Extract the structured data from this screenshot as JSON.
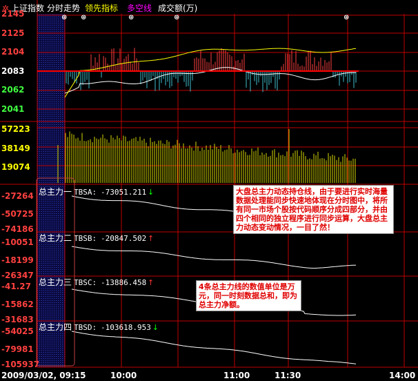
{
  "header": {
    "icon": "gear-icon",
    "items": [
      {
        "label": "上证指数",
        "color": "#ffffff"
      },
      {
        "label": "分时走势",
        "color": "#ffffff"
      },
      {
        "label": "领先指标",
        "color": "#ffff00"
      },
      {
        "label": "多空线",
        "color": "#ff00ff"
      },
      {
        "label": "成交额(万)",
        "color": "#ffffff"
      }
    ]
  },
  "price_axis": {
    "labels": [
      "2145",
      "2125",
      "2104",
      "2083",
      "2062",
      "2041"
    ]
  },
  "volume_axis": {
    "labels": [
      "57223",
      "38149",
      "19074"
    ]
  },
  "panels": [
    {
      "title": "总主力一",
      "tag": "TBSA:",
      "value": "-73051.211",
      "arrow": "↓",
      "arrow_color": "#00ff00",
      "labels": [
        "-27264",
        "-50725",
        "-74186"
      ]
    },
    {
      "title": "总主力二",
      "tag": "TBSB:",
      "value": "-20847.502",
      "arrow": "↑",
      "arrow_color": "#ff3333",
      "labels": [
        "-10051",
        "-18199",
        "-26347"
      ]
    },
    {
      "title": "总主力三",
      "tag": "TBSC:",
      "value": "-13886.458",
      "arrow": "↑",
      "arrow_color": "#ff3333",
      "labels": [
        "-41.27",
        "-15862",
        "-31683"
      ]
    },
    {
      "title": "总主力四",
      "tag": "TBSD:",
      "value": "-103618.953",
      "arrow": "↓",
      "arrow_color": "#00ff00",
      "labels": [
        "-54025",
        "-79981",
        "-105937"
      ]
    }
  ],
  "time_axis": {
    "labels": [
      "2009/03/02, 09:15",
      "10:00",
      "11:00",
      "11:30",
      "14:00"
    ]
  },
  "callouts": {
    "main": "大盘总主力动态持仓线，由于要进行实时海量数据处理能同步快速地体现在分时图中，将所有同一市场个股按代码顺序分成四部分，并由四个相同的独立程序进行同步运算，大盘总主力动态变动情况，一目了然！",
    "units": "4条总主力线的数值单位是万元，同一时刻数据总和，即为总主力净额。"
  },
  "colors": {
    "grid": "#c00000",
    "price_line": "#ffffff",
    "lead_line": "#ffff00",
    "up_bar": "#ff4040",
    "down_bar": "#40c0d0",
    "volume": "#d8d800"
  }
}
